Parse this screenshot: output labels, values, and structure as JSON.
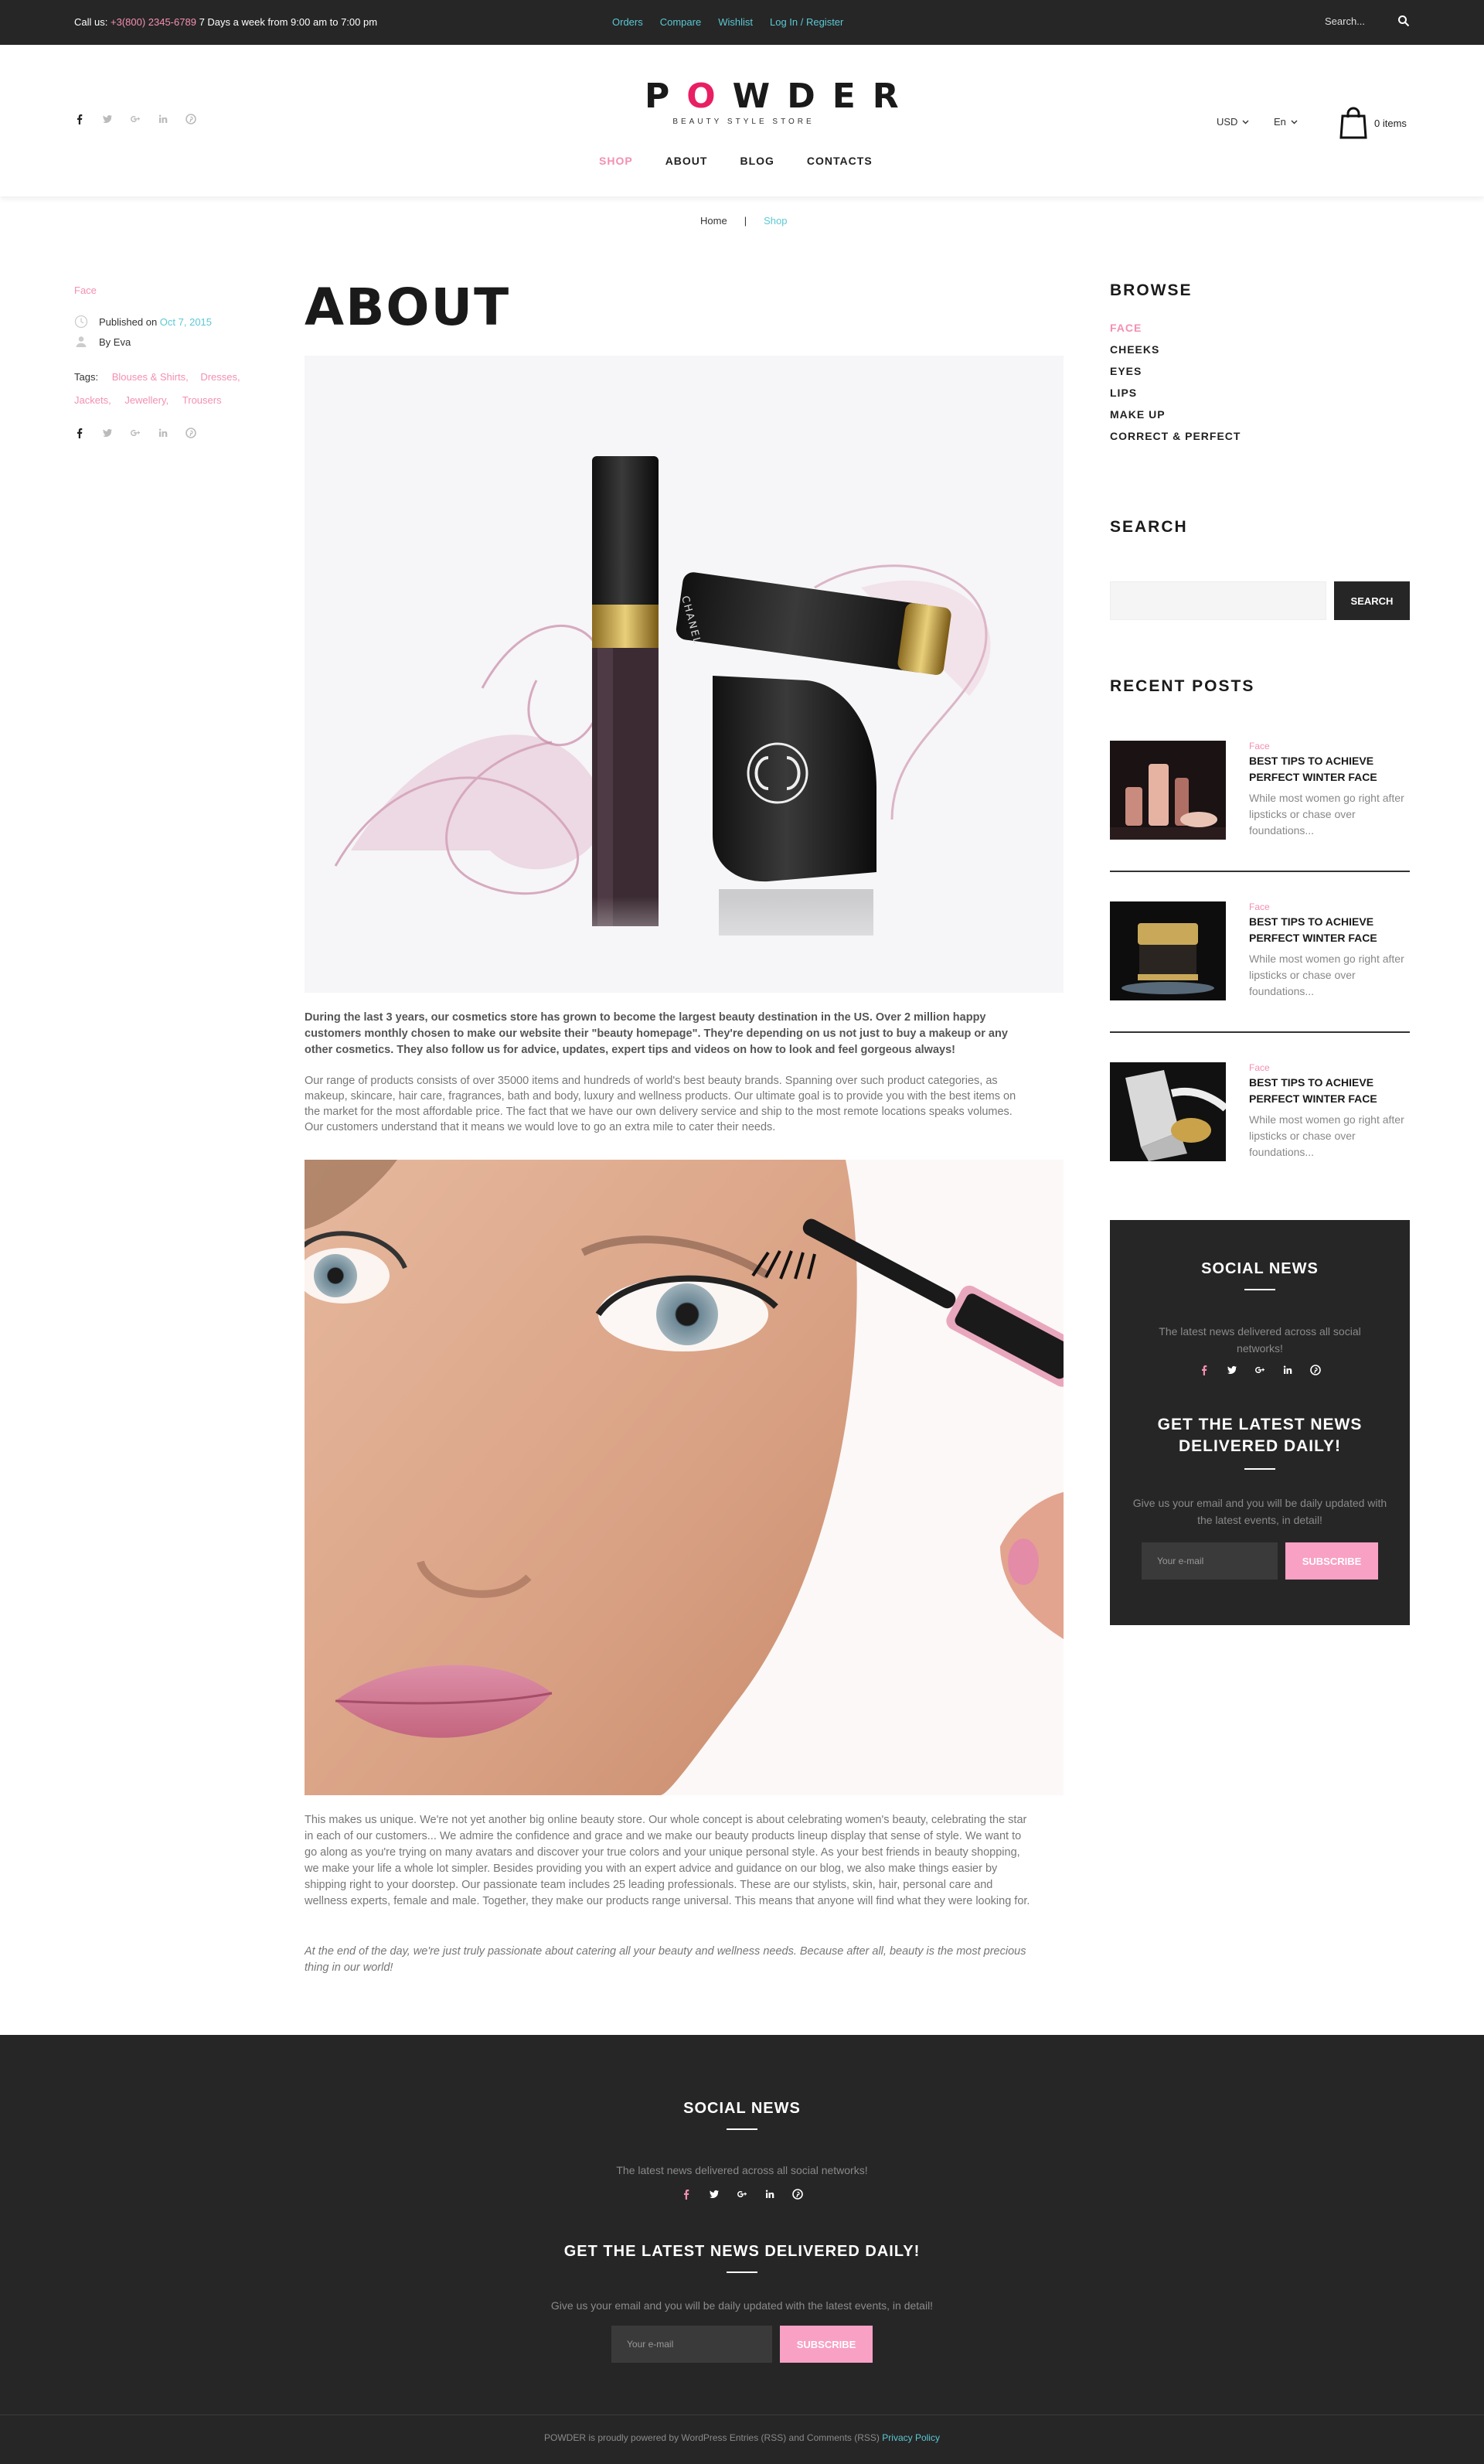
{
  "topbar": {
    "call_prefix": "Call us:",
    "phone": "+3(800) 2345-6789",
    "hours": "7 Days a week from 9:00 am to 7:00 pm",
    "links": [
      "Orders",
      "Compare",
      "Wishlist",
      "Log In / Register"
    ],
    "search_placeholder": "Search..."
  },
  "header": {
    "logo_word": "POWDER",
    "logo_tagline": "BEAUTY STYLE STORE",
    "nav": [
      "SHOP",
      "ABOUT",
      "BLOG",
      "CONTACTS"
    ],
    "currency": "USD",
    "language": "En",
    "cart_label": "0 items"
  },
  "breadcrumb": {
    "home": "Home",
    "separator": "|",
    "current": "Shop"
  },
  "meta": {
    "category": "Face",
    "published_prefix": "Published on",
    "published_date": "Oct 7, 2015",
    "author": "By Eva",
    "tags_label": "Tags:",
    "tags": [
      "Blouses & Shirts,",
      "Dresses,",
      "Jackets,",
      "Jewellery,",
      "Trousers"
    ]
  },
  "article": {
    "title": "ABOUT",
    "lead": "During the last 3 years, our cosmetics store has grown to become the largest beauty destination in the US. Over 2 million happy customers monthly chosen to make our website their \"beauty homepage\". They're depending on us not just to buy a makeup or any other cosmetics. They also follow us for advice, updates, expert tips and videos on how to look and feel gorgeous always!",
    "paragraph_1": "Our range of products consists of over 35000 items and hundreds of world's best beauty brands. Spanning over such product categories, as makeup, skincare, hair care, fragrances, bath and body, luxury and wellness products. Our ultimate goal is to provide you with the best items on the market for the most affordable price. The fact that we have our own delivery service and ship to the most remote locations speaks volumes. Our customers understand that it means we would love to go an extra mile to cater their needs.",
    "paragraph_2": "This makes us unique. We're not yet another big online beauty store. Our whole concept is about celebrating women's beauty, celebrating the star in each of our customers... We admire the confidence and grace and we make our beauty products lineup display that sense of style. We want to go along as you're trying on many avatars and discover your true colors and your unique personal style. As your best friends in beauty shopping, we make your life a whole lot simpler.  Besides providing you with an expert advice and guidance on our blog, we also make things easier by shipping right to your doorstep. Our passionate team includes 25 leading professionals. These are our stylists, skin, hair, personal care and wellness experts, female and male. Together, they make our products range universal. This means that anyone will find what they were looking for.",
    "paragraph_3": "At the end of the day, we're just truly passionate about catering all your beauty and wellness needs. Because after all, beauty is the most precious thing in our world!",
    "brand_text": "CHANEL"
  },
  "sidebar": {
    "browse_title": "BROWSE",
    "browse_items": [
      "FACE",
      "CHEEKS",
      "EYES",
      "LIPS",
      "MAKE UP",
      "CORRECT & PERFECT"
    ],
    "search_title": "SEARCH",
    "search_button": "SEARCH",
    "recent_title": "RECENT POSTS",
    "posts": [
      {
        "category": "Face",
        "title": "BEST TIPS TO ACHIEVE PERFECT WINTER FACE",
        "excerpt": "While most women go right after lipsticks or chase over foundations..."
      },
      {
        "category": "Face",
        "title": "BEST TIPS TO ACHIEVE PERFECT WINTER FACE",
        "excerpt": "While most women go right after lipsticks or chase over foundations..."
      },
      {
        "category": "Face",
        "title": "BEST TIPS TO ACHIEVE PERFECT WINTER FACE",
        "excerpt": "While most women go right after lipsticks or chase over foundations..."
      }
    ],
    "widget": {
      "social_title": "SOCIAL NEWS",
      "social_text": "The latest news delivered across all social networks!",
      "daily_title": "GET THE LATEST NEWS DELIVERED DAILY!",
      "daily_text": "Give us your email and you will be daily updated with the latest events, in detail!",
      "email_placeholder": "Your e-mail",
      "subscribe": "SUBSCRIBE"
    }
  },
  "footer": {
    "social_title": "SOCIAL NEWS",
    "social_text": "The latest news delivered across all social networks!",
    "daily_title": "GET THE LATEST NEWS DELIVERED DAILY!",
    "daily_text": "Give us your email and you will be daily updated with the latest events, in detail!",
    "email_placeholder": "Your e-mail",
    "subscribe": "SUBSCRIBE",
    "copyright": "POWDER is proudly powered by WordPress Entries (RSS) and Comments (RSS)",
    "privacy": "Privacy Policy"
  },
  "colors": {
    "accent_pink": "#f48fb1",
    "accent_cyan": "#5bc8d4",
    "dark": "#262626"
  }
}
